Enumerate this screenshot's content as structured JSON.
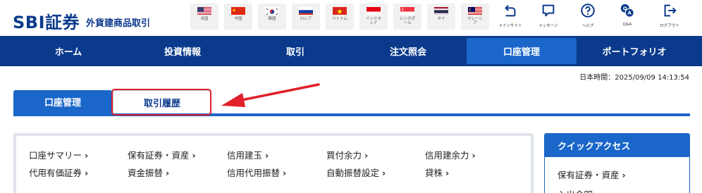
{
  "header": {
    "logo": "SBI証券",
    "subtitle": "外貨建商品取引",
    "flags": [
      {
        "label": "米国",
        "icon": "us-flag-icon"
      },
      {
        "label": "中国",
        "icon": "china-flag-icon"
      },
      {
        "label": "韓国",
        "icon": "korea-flag-icon"
      },
      {
        "label": "ロシア",
        "icon": "russia-flag-icon"
      },
      {
        "label": "ベトナム",
        "icon": "vietnam-flag-icon"
      },
      {
        "label": "インドネ\nシア",
        "icon": "indonesia-flag-icon"
      },
      {
        "label": "シンガポ\nール",
        "icon": "singapore-flag-icon"
      },
      {
        "label": "タイ",
        "icon": "thailand-flag-icon"
      },
      {
        "label": "マレーシ\nア",
        "icon": "malaysia-flag-icon"
      }
    ],
    "utilities": [
      {
        "label": "メインサイト",
        "icon": "return-icon"
      },
      {
        "label": "メッセージ",
        "icon": "message-icon"
      },
      {
        "label": "ヘルプ",
        "icon": "help-icon"
      },
      {
        "label": "Q&A",
        "icon": "qa-icon"
      },
      {
        "label": "ログアウト",
        "icon": "logout-icon"
      }
    ]
  },
  "nav": {
    "items": [
      "ホーム",
      "投資情報",
      "取引",
      "注文照会",
      "口座管理",
      "ポートフォリオ"
    ],
    "active": "口座管理"
  },
  "timestamp": "日本時間：2025/09/09 14:13:54",
  "tabs": {
    "active": "口座管理",
    "inactive": "取引履歴"
  },
  "links": [
    [
      "口座サマリー",
      "保有証券・資産",
      "信用建玉",
      "買付余力",
      "信用建余力"
    ],
    [
      "代用有価証券",
      "資金振替",
      "信用代用振替",
      "自動振替設定",
      "貸株"
    ]
  ],
  "quick_access": {
    "title": "クイックアクセス",
    "items": [
      "保有証券・資産",
      "入出金明"
    ]
  },
  "colors": {
    "navy": "#0b3a8c",
    "accent_blue": "#1b66c9",
    "highlight_red": "#e0202a"
  }
}
